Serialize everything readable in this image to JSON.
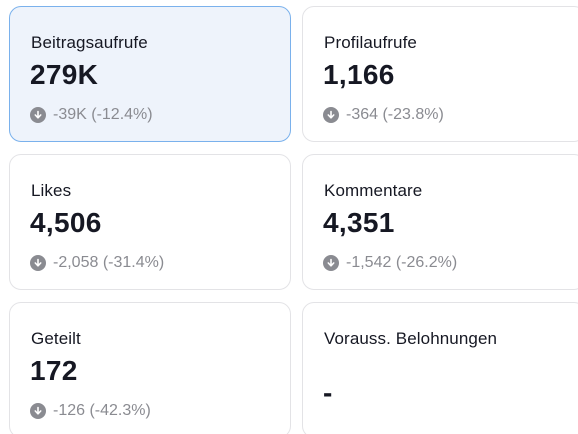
{
  "cards": [
    {
      "label": "Beitragsaufrufe",
      "value": "279K",
      "change": "-39K (-12.4%)",
      "selected": true
    },
    {
      "label": "Profilaufrufe",
      "value": "1,166",
      "change": "-364 (-23.8%)",
      "selected": false
    },
    {
      "label": "Likes",
      "value": "4,506",
      "change": "-2,058 (-31.4%)",
      "selected": false
    },
    {
      "label": "Kommentare",
      "value": "4,351",
      "change": "-1,542 (-26.2%)",
      "selected": false
    },
    {
      "label": "Geteilt",
      "value": "172",
      "change": "-126 (-42.3%)",
      "selected": false
    },
    {
      "label": "Vorauss. Belohnungen",
      "value": "-",
      "change": "",
      "selected": false
    }
  ],
  "colors": {
    "selected_bg": "#eef3fb",
    "selected_border": "#7ab1ec",
    "text": "#161823",
    "muted": "#8a8b91"
  }
}
